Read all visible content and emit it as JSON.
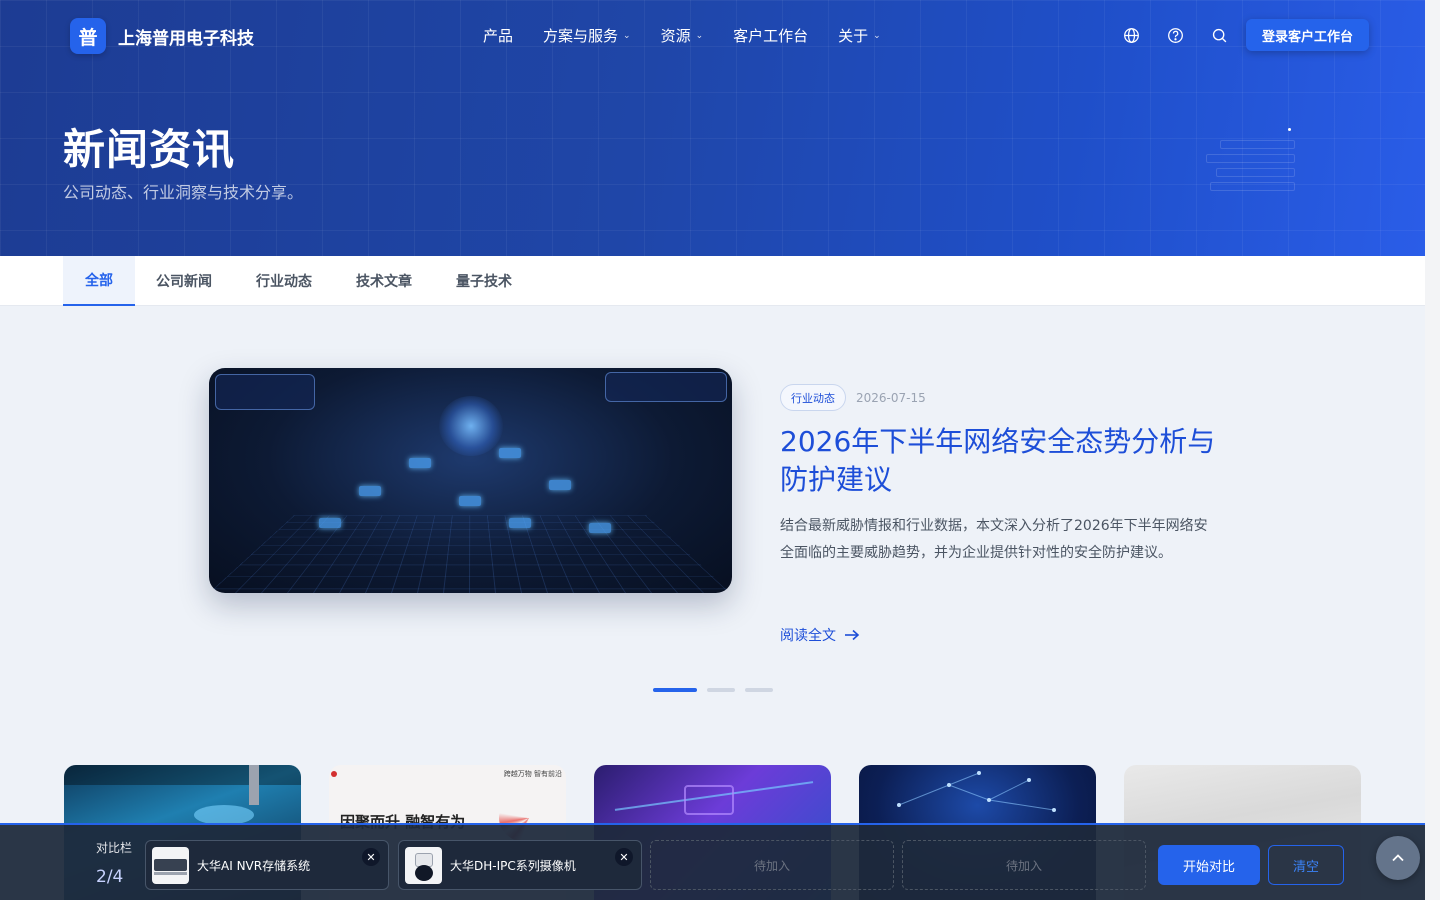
{
  "brand": {
    "logo_char": "普",
    "name": "上海普用电子科技"
  },
  "nav": {
    "items": [
      {
        "label": "产品",
        "has_dropdown": false
      },
      {
        "label": "方案与服务",
        "has_dropdown": true
      },
      {
        "label": "资源",
        "has_dropdown": true
      },
      {
        "label": "客户工作台",
        "has_dropdown": false
      },
      {
        "label": "关于",
        "has_dropdown": true
      }
    ],
    "icons": [
      "globe-icon",
      "help-icon",
      "search-icon"
    ],
    "login_label": "登录客户工作台"
  },
  "hero": {
    "title": "新闻资讯",
    "subtitle": "公司动态、行业洞察与技术分享。"
  },
  "tabs": [
    {
      "label": "全部",
      "active": true
    },
    {
      "label": "公司新闻",
      "active": false
    },
    {
      "label": "行业动态",
      "active": false
    },
    {
      "label": "技术文章",
      "active": false
    },
    {
      "label": "量子技术",
      "active": false
    }
  ],
  "featured": {
    "category": "行业动态",
    "date": "2026-07-15",
    "title": "2026年下半年网络安全态势分析与防护建议",
    "description": "结合最新威胁情报和行业数据，本文深入分析了2026年下半年网络安全面临的主要威胁趋势，并为企业提供针对性的安全防护建议。",
    "read_more": "阅读全文",
    "read_more_icon": "arrow-right-icon"
  },
  "carousel": {
    "total": 3,
    "active_index": 0
  },
  "cards": {
    "card2_headline": "因聚而升 融智有为",
    "card2_tag": "跨越万物 智有前沿"
  },
  "compare": {
    "label": "对比栏",
    "count": "2/4",
    "slots": [
      {
        "name": "大华AI NVR存储系统",
        "filled": true
      },
      {
        "name": "大华DH-IPC系列摄像机",
        "filled": true
      },
      {
        "name": "待加入",
        "filled": false
      },
      {
        "name": "待加入",
        "filled": false
      }
    ],
    "start_label": "开始对比",
    "clear_label": "清空"
  },
  "colors": {
    "primary": "#2563eb",
    "hero_dark": "#1d3c93",
    "title_blue": "#1d4ed8"
  }
}
